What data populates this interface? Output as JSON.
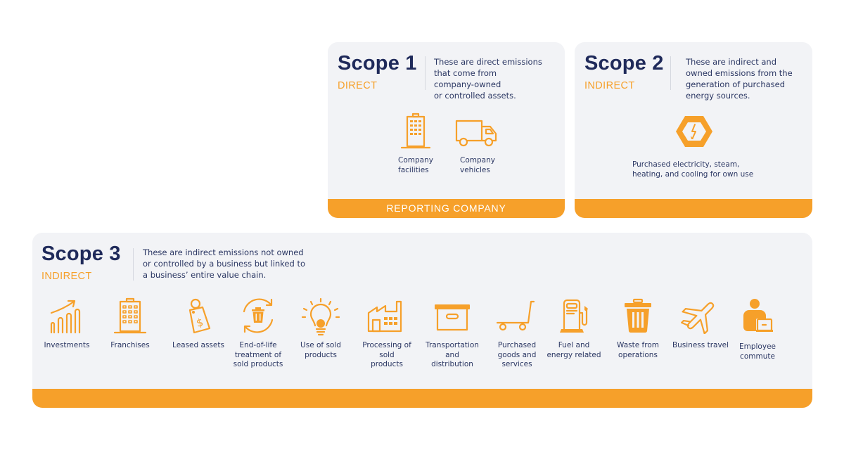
{
  "accent_color": "#f6a02a",
  "title_color": "#1f2a5a",
  "scope1": {
    "title": "Scope 1",
    "subtitle": "DIRECT",
    "description": [
      "These are direct emissions",
      "that come from",
      "company-owned",
      "or controlled assets."
    ],
    "items": [
      {
        "icon": "building-icon",
        "label": [
          "Company",
          "facilities"
        ]
      },
      {
        "icon": "truck-icon",
        "label": [
          "Company",
          "vehicles"
        ]
      }
    ],
    "footer": "REPORTING COMPANY"
  },
  "scope2": {
    "title": "Scope 2",
    "subtitle": "INDIRECT",
    "description": [
      "These are indirect and",
      "owned emissions from the",
      "generation of purchased",
      "energy sources."
    ],
    "items": [
      {
        "icon": "electricity-hexagon-icon",
        "label": [
          "Purchased electricity, steam,",
          "heating, and cooling for own use"
        ]
      }
    ]
  },
  "scope3": {
    "title": "Scope 3",
    "subtitle": "INDIRECT",
    "description": [
      "These are indirect emissions not owned",
      "or controlled by a business but linked to",
      "a business’ entire value chain."
    ],
    "items": [
      {
        "icon": "investments-chart-icon",
        "label": [
          "Investments"
        ]
      },
      {
        "icon": "building-icon",
        "label": [
          "Franchises"
        ]
      },
      {
        "icon": "price-tag-icon",
        "label": [
          "Leased assets"
        ]
      },
      {
        "icon": "recycle-bin-icon",
        "label": [
          "End-of-life",
          "treatment of",
          "sold products"
        ]
      },
      {
        "icon": "lightbulb-icon",
        "label": [
          "Use of sold",
          "products"
        ]
      },
      {
        "icon": "factory-icon",
        "label": [
          "Processing of",
          "sold",
          "products"
        ]
      },
      {
        "icon": "box-icon",
        "label": [
          "Transportation",
          "and",
          "distribution"
        ]
      },
      {
        "icon": "cart-icon",
        "label": [
          "Purchased",
          "goods and",
          "services"
        ]
      },
      {
        "icon": "fuel-pump-icon",
        "label": [
          "Fuel and",
          "energy related"
        ]
      },
      {
        "icon": "trash-can-icon",
        "label": [
          "Waste from",
          "operations"
        ]
      },
      {
        "icon": "airplane-icon",
        "label": [
          "Business travel"
        ]
      },
      {
        "icon": "employee-laptop-icon",
        "label": [
          "Employee",
          "commute"
        ]
      }
    ]
  }
}
